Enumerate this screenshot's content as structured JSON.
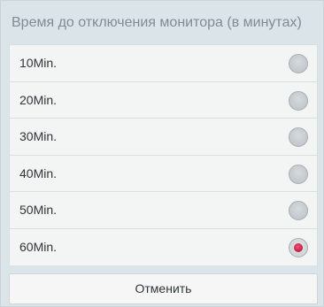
{
  "dialog": {
    "title": "Время до отключения монитора (в минутах)",
    "options": [
      {
        "label": "10Min.",
        "selected": false
      },
      {
        "label": "20Min.",
        "selected": false
      },
      {
        "label": "30Min.",
        "selected": false
      },
      {
        "label": "40Min.",
        "selected": false
      },
      {
        "label": "50Min.",
        "selected": false
      },
      {
        "label": "60Min.",
        "selected": true
      }
    ],
    "cancel_label": "Отменить"
  },
  "colors": {
    "background": "#dbe4e9",
    "selected_radio": "#c9173e"
  }
}
